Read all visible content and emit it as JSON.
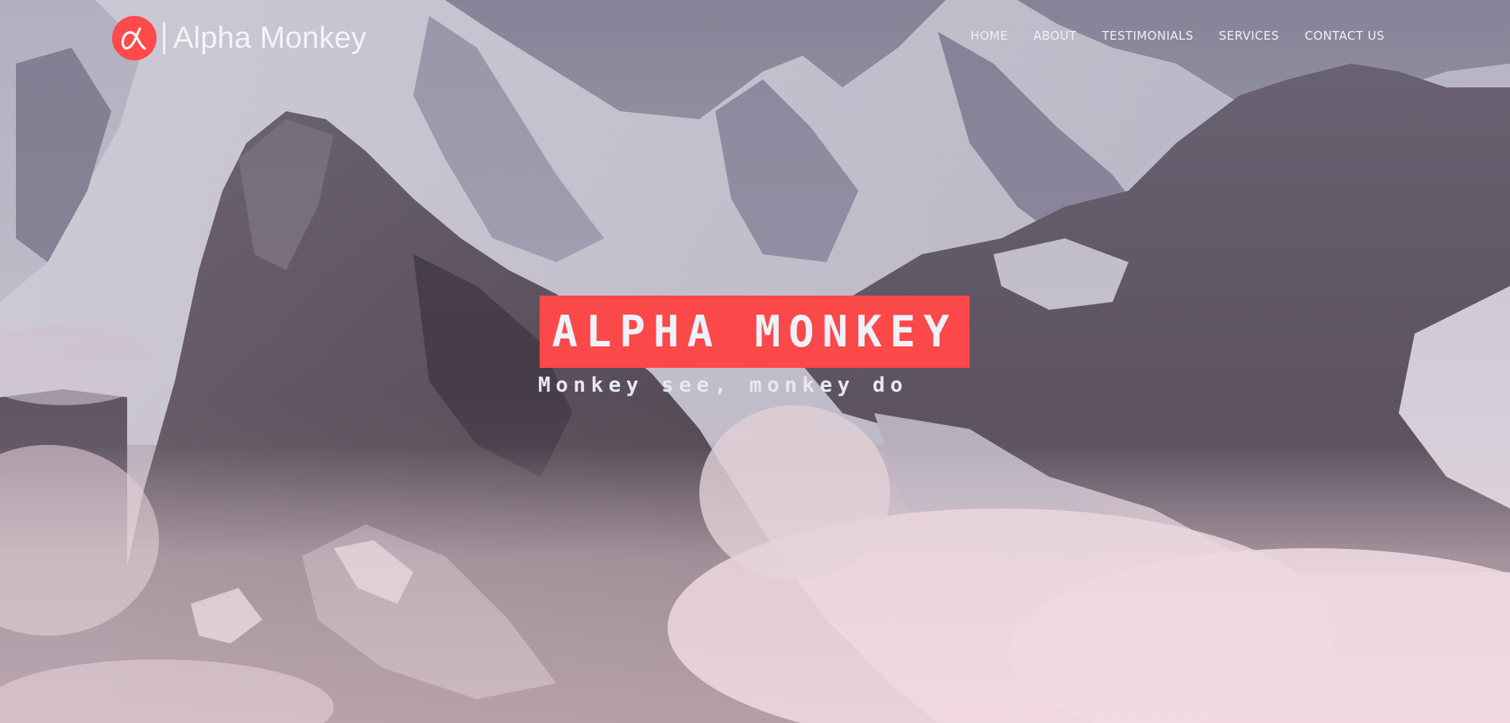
{
  "header": {
    "brand_name": "Alpha Monkey",
    "brand_icon": "alpha-symbol-icon",
    "nav": [
      {
        "label": "HOME"
      },
      {
        "label": "ABOUT"
      },
      {
        "label": "TESTIMONIALS"
      },
      {
        "label": "SERVICES"
      },
      {
        "label": "CONTACT US"
      }
    ]
  },
  "hero": {
    "title": "ALPHA MONKEY",
    "tagline": "Monkey see, monkey do",
    "background": "snowy-mountain-peaks-photo"
  },
  "colors": {
    "accent": "#fb4848",
    "text": "#eef1f8"
  }
}
